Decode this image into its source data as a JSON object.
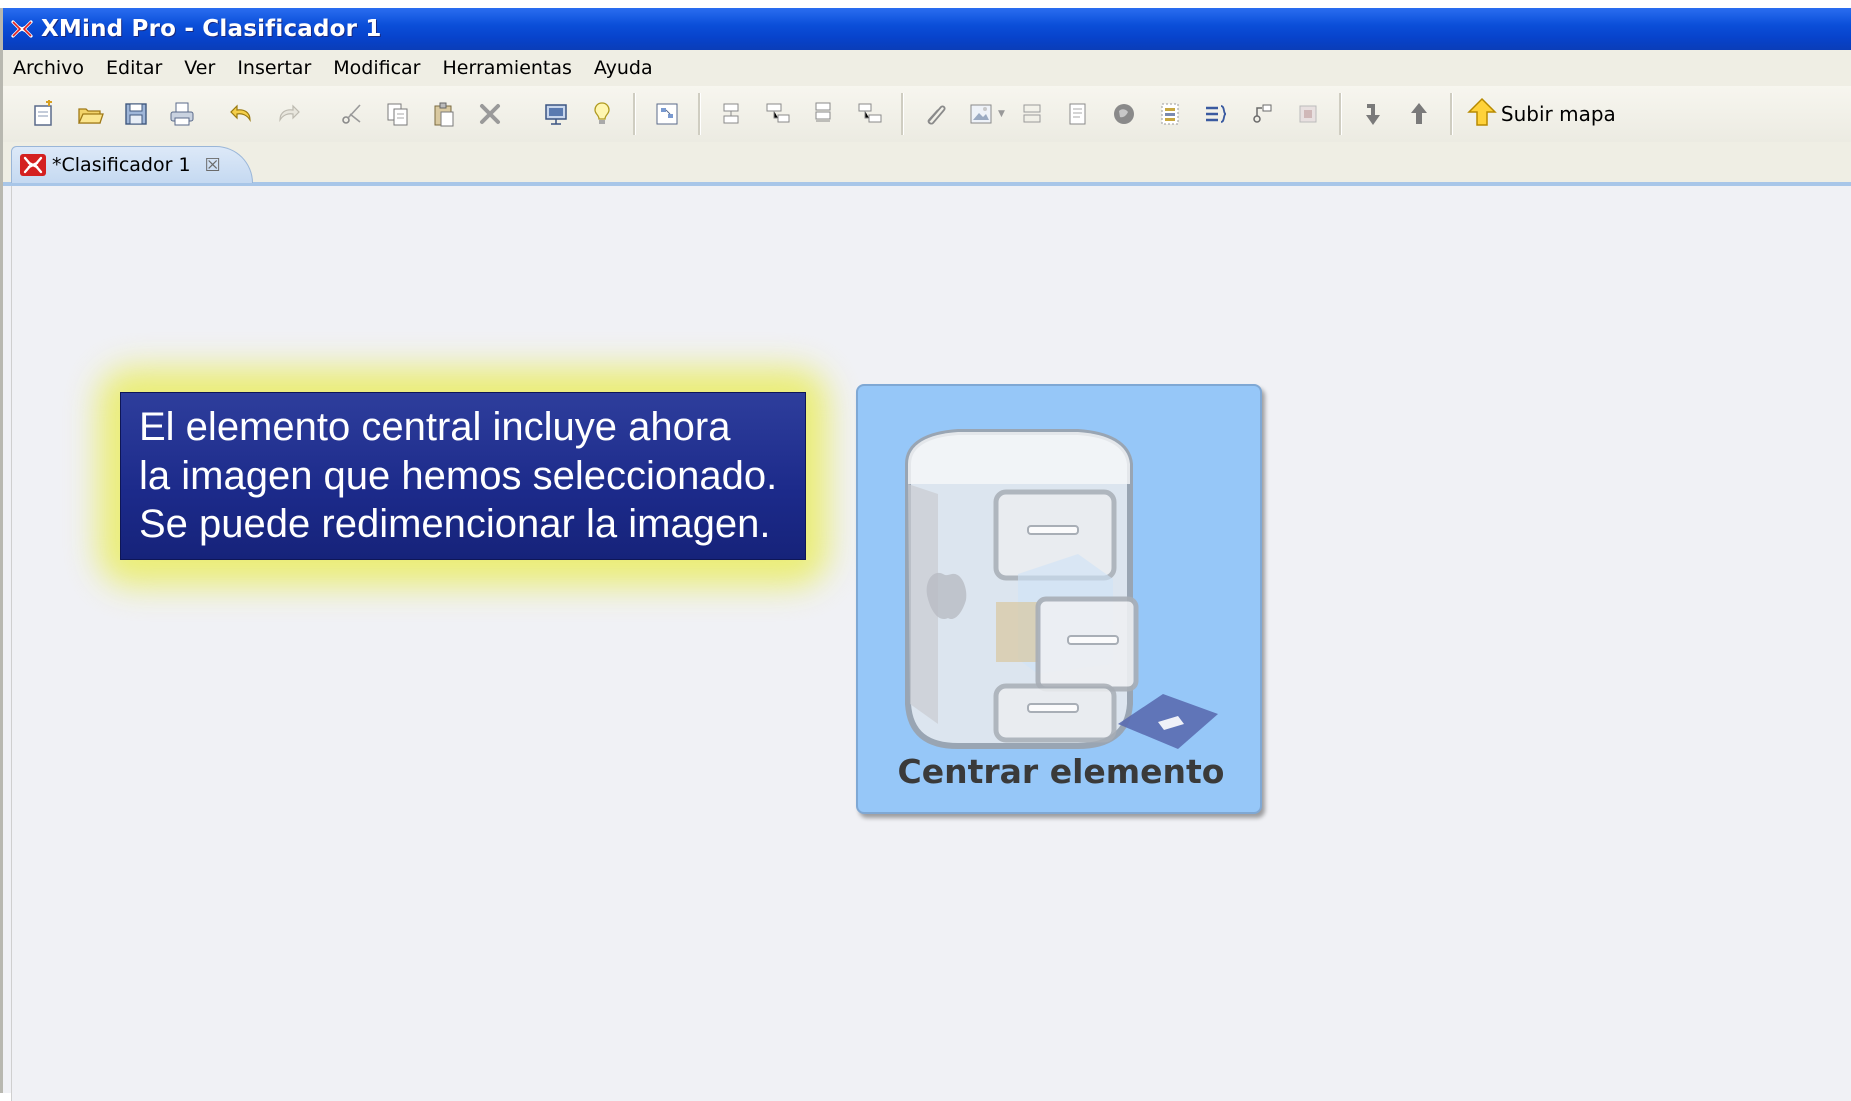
{
  "window": {
    "title": "XMind Pro - Clasificador 1",
    "title_bar_color": "#0b4fd9"
  },
  "menubar": {
    "items": [
      "Archivo",
      "Editar",
      "Ver",
      "Insertar",
      "Modificar",
      "Herramientas",
      "Ayuda"
    ]
  },
  "toolbar": {
    "icons": [
      "new-icon",
      "open-icon",
      "save-icon",
      "print-icon",
      "undo-icon",
      "redo-icon",
      "cut-icon",
      "copy-icon",
      "paste-icon",
      "delete-icon",
      "presentation-icon",
      "brainstorm-icon",
      "new-sheet-icon",
      "topic-icon",
      "subtopic-icon",
      "callout-topic-icon",
      "floating-topic-icon",
      "hyperlink-icon",
      "image-icon",
      "boundary-icon",
      "notes-icon",
      "marker-icon",
      "relationship-icon",
      "summary-icon",
      "label-icon",
      "filter-icon",
      "drill-down-icon",
      "drill-up-icon"
    ],
    "subir_mapa_label": "Subir mapa"
  },
  "tabs": [
    {
      "label": "*Clasificador 1"
    }
  ],
  "callout": {
    "lines": [
      "El elemento central incluye ahora",
      "la imagen que hemos seleccionado.",
      "Se puede redimencionar la imagen."
    ],
    "background": "#1c2a8a",
    "glow": "#eaed6a"
  },
  "central_topic": {
    "label": "Centrar elemento",
    "background": "#96c7f8",
    "image_icon": "file-cabinet-icon"
  }
}
